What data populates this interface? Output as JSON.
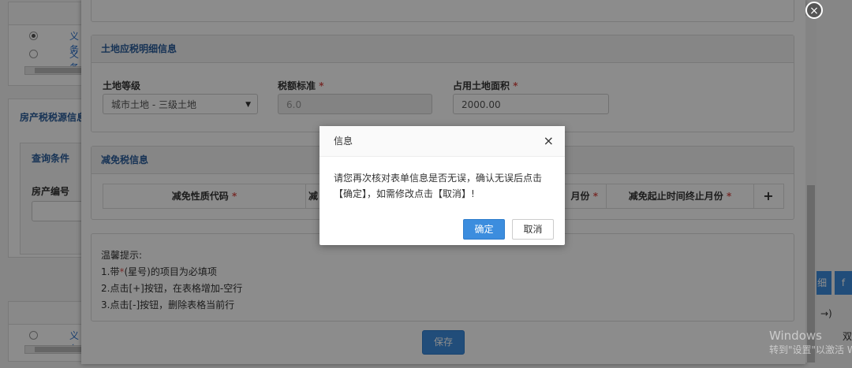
{
  "background": {
    "table_link_1": "义务",
    "table_link_2": "义务",
    "table_link_3": "义务",
    "house_section_title": "房产税税源信息",
    "query_conditions": "查询条件",
    "house_number_label": "房产编号",
    "right_btn_1": "细",
    "right_btn_2": "f",
    "right_cell_1": "→)",
    "right_cell_2": "双",
    "watermark_line1": "Windows",
    "watermark_line2": "转到\"设置\"以激活 Windows"
  },
  "main_dialog": {
    "top_panel_placeholder": "",
    "land_section": {
      "title": "土地应税明细信息",
      "grade_label": "土地等级",
      "grade_value": "城市土地 - 三级土地",
      "tax_std_label": "税额标准",
      "tax_std_value": "6.0",
      "area_label": "占用土地面积",
      "area_value": "2000.00",
      "required_mark": "*"
    },
    "relief_section": {
      "title": "减免税信息",
      "col_nature_code": "减免性质代码",
      "col_partial": "减",
      "col_start_month_partial": "月份",
      "col_end_month": "减免起止时间终止月份",
      "add_label": "+",
      "required_mark": "*"
    },
    "tips": {
      "heading": "温馨提示:",
      "line1_prefix": "1.带",
      "line1_star": "*",
      "line1_suffix": "(星号)的项目为必填项",
      "line2": "2.点击[+]按钮，在表格增加-空行",
      "line3": "3.点击[-]按钮，删除表格当前行"
    },
    "save_label": "保存",
    "close_icon_label": "×"
  },
  "confirm_dialog": {
    "title": "信息",
    "close_label": "×",
    "message": "请您再次核对表单信息是否无误，确认无误后点击【确定】，如需修改点击【取消】!",
    "ok_label": "确定",
    "cancel_label": "取消"
  },
  "colors": {
    "accent": "#3c8dde",
    "section_title": "#2a5d9c",
    "required": "#d9534f"
  }
}
